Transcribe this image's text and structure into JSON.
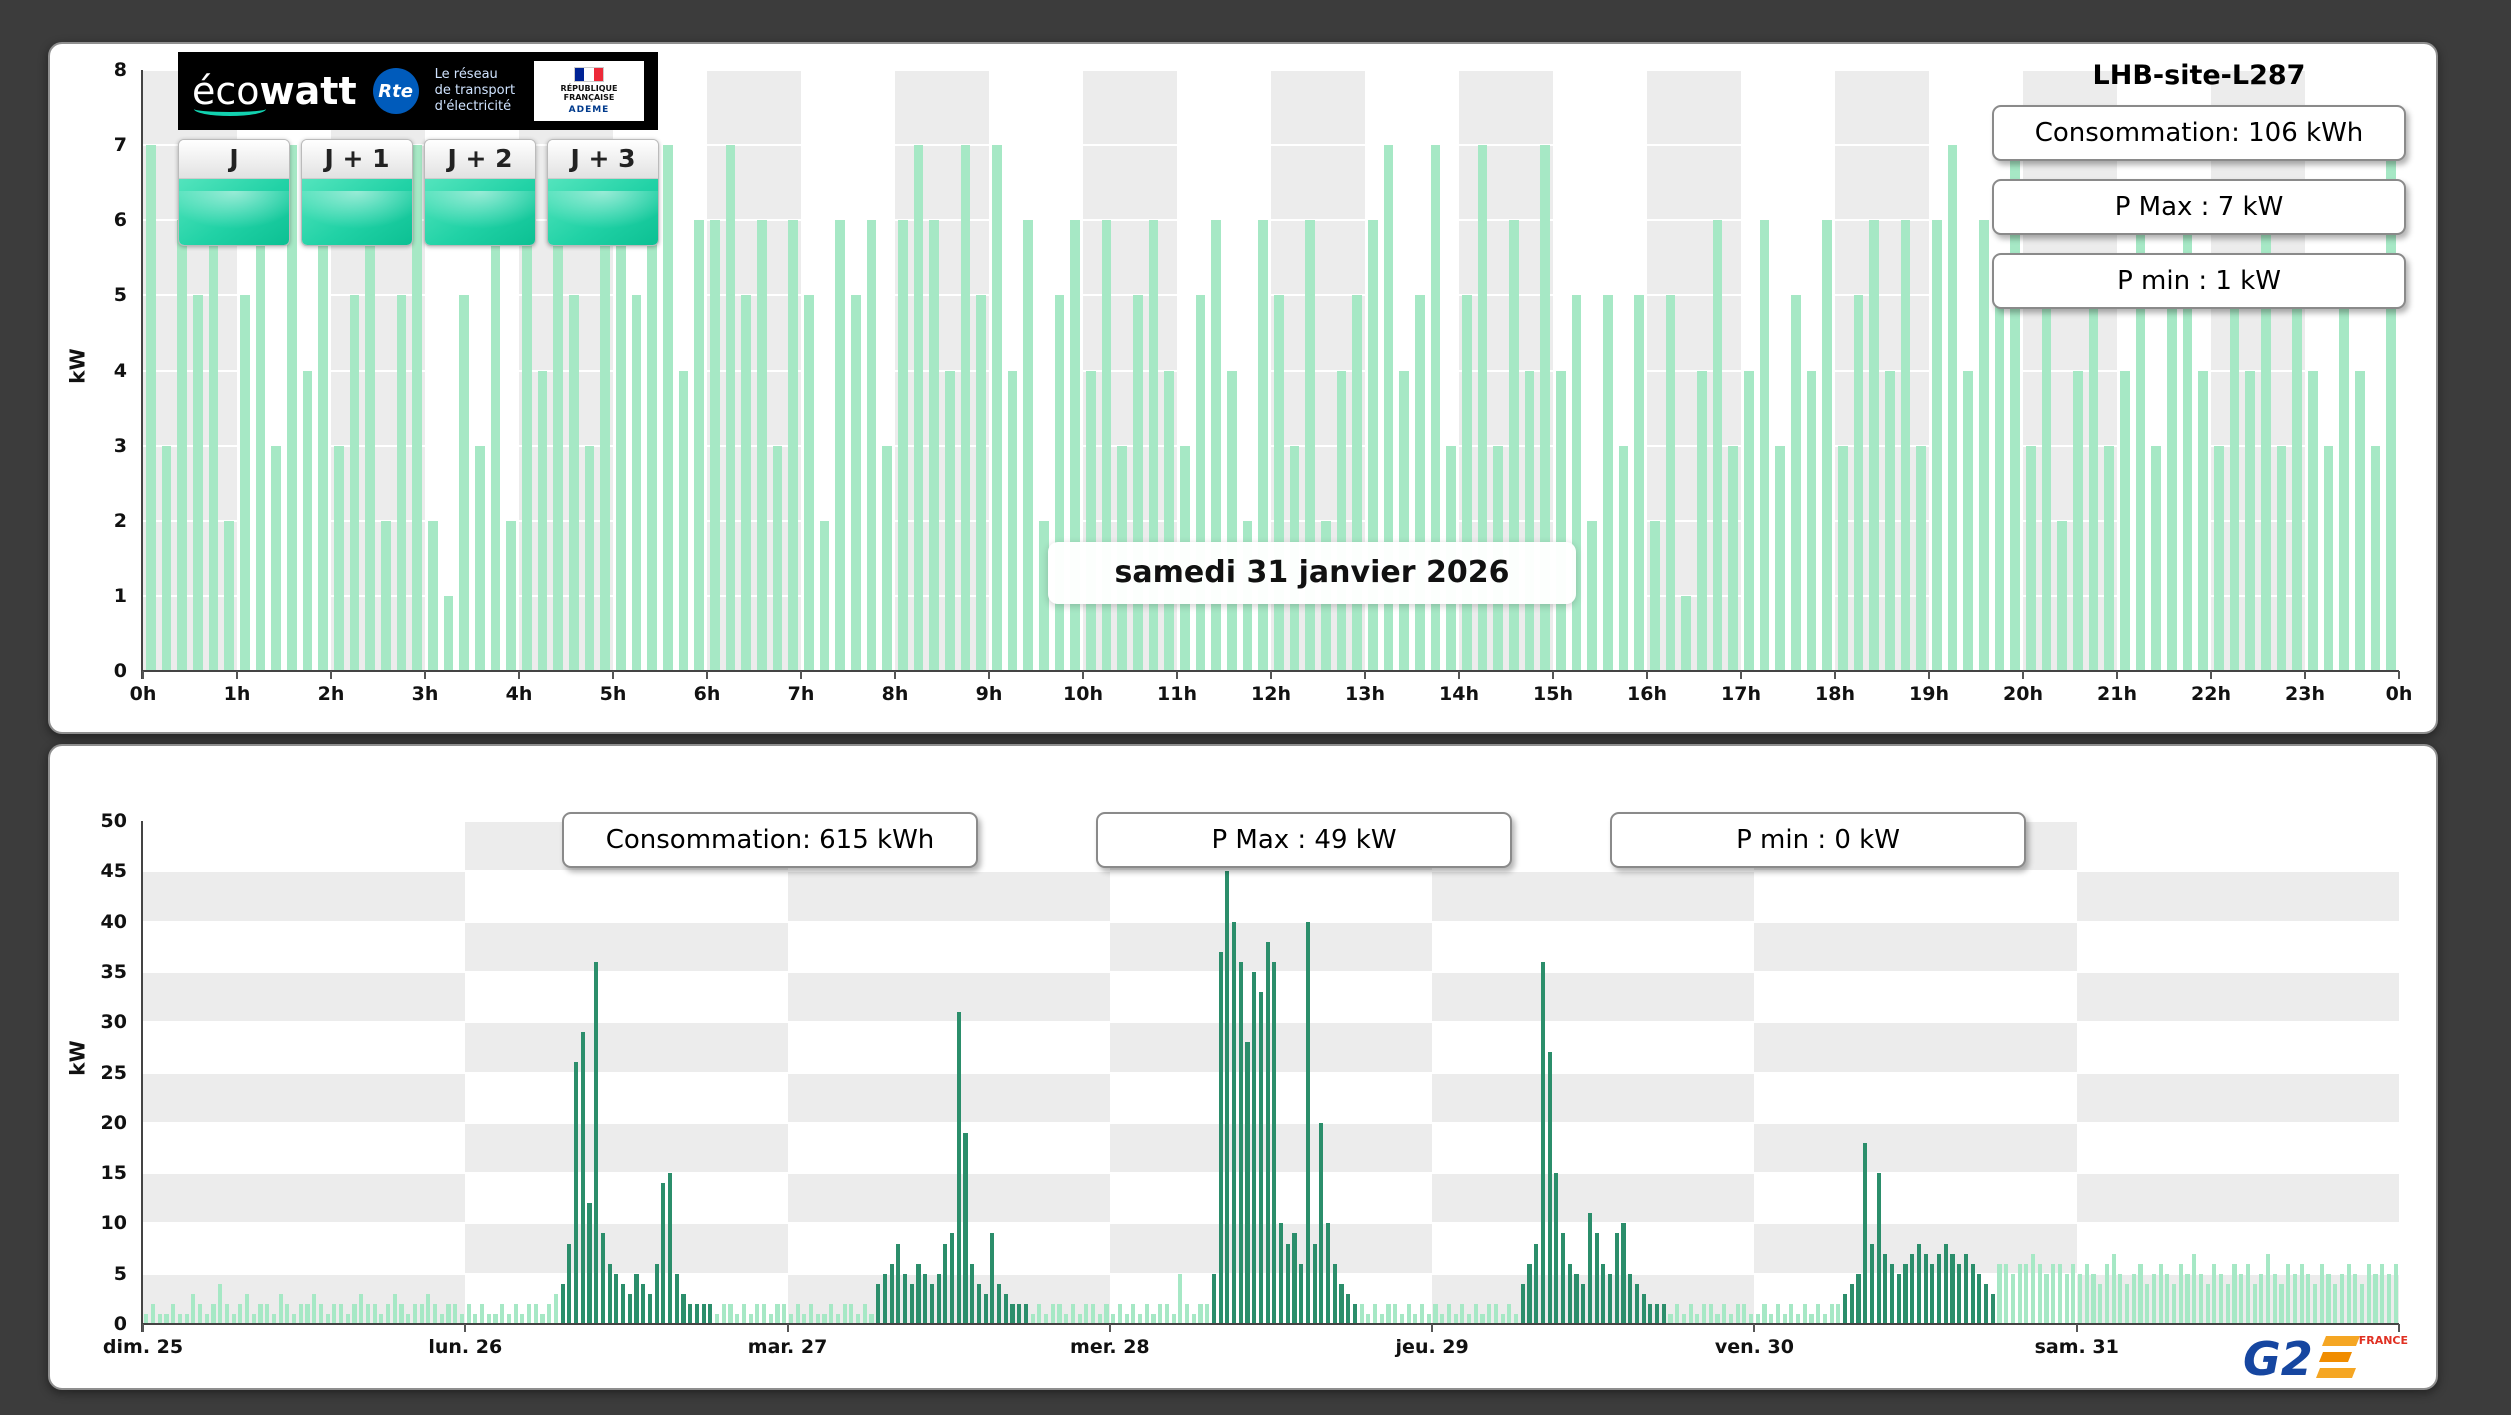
{
  "top_panel": {
    "site_title": "LHB-site-L287",
    "stats": [
      {
        "label": "Consommation: 106 kWh"
      },
      {
        "label": "P Max :  7 kW"
      },
      {
        "label": "P min : 1 kW"
      }
    ],
    "ecowatt": {
      "brand_light": "éco",
      "brand_bold": "watt",
      "rte_badge": "Rte",
      "rte_caption": "Le réseau de transport d'électricité",
      "gov_caption": "RÉPUBLIQUE FRANÇAISE",
      "ademe": "ADEME",
      "tabs": [
        {
          "label": "J"
        },
        {
          "label": "J + 1"
        },
        {
          "label": "J + 2"
        },
        {
          "label": "J + 3"
        }
      ]
    }
  },
  "bottom_panel": {
    "stats": [
      {
        "label": "Consommation: 615 kWh"
      },
      {
        "label": "P Max :  49 kW"
      },
      {
        "label": "P min : 0 kW"
      }
    ],
    "logo": {
      "g2": "G2",
      "france": "FRANCE"
    }
  },
  "colors": {
    "bar_light": "#a6e8c5",
    "bar_dark": "#2b8e6b",
    "band_gray": "#ececec",
    "page_background": "#3c3c3c",
    "ecowatt_teal": "#12d2b0",
    "rte_blue": "#005bbb",
    "g2e_blue": "#1646a0",
    "g2e_orange": "#f5a623"
  },
  "chart_data": [
    {
      "type": "bar",
      "title": "samedi 31 janvier 2026",
      "ylabel": "kW",
      "ylim": [
        0,
        8
      ],
      "yticks": [
        0,
        1,
        2,
        3,
        4,
        5,
        6,
        7,
        8
      ],
      "xticklabels": [
        "0h",
        "1h",
        "2h",
        "3h",
        "4h",
        "5h",
        "6h",
        "7h",
        "8h",
        "9h",
        "10h",
        "11h",
        "12h",
        "13h",
        "14h",
        "15h",
        "16h",
        "17h",
        "18h",
        "19h",
        "20h",
        "21h",
        "22h",
        "23h",
        "0h"
      ],
      "interval_minutes": 10,
      "bar_color": "#a6e8c5",
      "grid": "hour-stripes",
      "values": [
        7,
        3,
        6,
        5,
        7,
        2,
        5,
        6,
        3,
        7,
        4,
        6,
        3,
        5,
        6,
        2,
        5,
        7,
        2,
        1,
        5,
        3,
        6,
        2,
        6,
        4,
        7,
        5,
        3,
        6,
        7,
        5,
        6,
        7,
        4,
        6,
        6,
        7,
        5,
        6,
        3,
        6,
        5,
        2,
        6,
        5,
        6,
        3,
        6,
        7,
        6,
        4,
        7,
        5,
        7,
        4,
        6,
        2,
        5,
        6,
        4,
        6,
        3,
        5,
        6,
        4,
        3,
        5,
        6,
        4,
        2,
        6,
        5,
        3,
        6,
        2,
        4,
        5,
        6,
        7,
        4,
        5,
        7,
        3,
        5,
        7,
        3,
        6,
        4,
        7,
        4,
        5,
        2,
        5,
        3,
        5,
        2,
        5,
        1,
        4,
        6,
        3,
        4,
        6,
        3,
        5,
        4,
        6,
        3,
        5,
        6,
        4,
        6,
        3,
        6,
        7,
        4,
        6,
        5,
        7,
        3,
        5,
        2,
        4,
        5,
        3,
        4,
        6,
        3,
        5,
        6,
        4,
        3,
        5,
        4,
        6,
        3,
        5,
        4,
        3,
        5,
        4,
        3,
        7
      ]
    },
    {
      "type": "bar",
      "title": "",
      "ylabel": "kW",
      "ylim": [
        0,
        50
      ],
      "yticks": [
        0,
        5,
        10,
        15,
        20,
        25,
        30,
        35,
        40,
        45,
        50
      ],
      "xticklabels": [
        "dim. 25",
        "lun. 26",
        "mar. 27",
        "mer. 28",
        "jeu. 29",
        "ven. 30",
        "sam. 31"
      ],
      "interval_minutes": 30,
      "bar_color": "#a6e8c5",
      "peak_color": "#2b8e6b",
      "grid": "checkerboard",
      "dark_ranges": [
        [
          62,
          84
        ],
        [
          109,
          131
        ],
        [
          159,
          180
        ],
        [
          205,
          226
        ],
        [
          253,
          275
        ]
      ],
      "values": [
        1,
        2,
        1,
        1,
        2,
        1,
        1,
        3,
        2,
        1,
        2,
        4,
        2,
        1,
        2,
        3,
        1,
        2,
        2,
        1,
        3,
        2,
        1,
        2,
        2,
        3,
        2,
        1,
        2,
        2,
        1,
        2,
        3,
        2,
        2,
        1,
        2,
        3,
        2,
        1,
        2,
        2,
        3,
        2,
        1,
        2,
        2,
        1,
        2,
        1,
        2,
        1,
        1,
        2,
        1,
        2,
        1,
        2,
        2,
        1,
        2,
        3,
        4,
        8,
        26,
        29,
        12,
        36,
        9,
        6,
        5,
        4,
        3,
        5,
        4,
        3,
        6,
        14,
        15,
        5,
        3,
        2,
        2,
        2,
        2,
        1,
        2,
        2,
        1,
        2,
        1,
        2,
        2,
        1,
        2,
        2,
        1,
        2,
        1,
        2,
        1,
        1,
        2,
        1,
        2,
        2,
        1,
        2,
        1,
        4,
        5,
        6,
        8,
        5,
        4,
        6,
        5,
        4,
        5,
        8,
        9,
        31,
        19,
        6,
        4,
        3,
        9,
        4,
        3,
        2,
        2,
        2,
        1,
        2,
        1,
        2,
        2,
        1,
        2,
        1,
        2,
        2,
        1,
        2,
        1,
        2,
        1,
        2,
        1,
        2,
        1,
        2,
        2,
        1,
        5,
        2,
        1,
        2,
        2,
        5,
        37,
        45,
        40,
        36,
        28,
        35,
        33,
        38,
        36,
        10,
        8,
        9,
        6,
        40,
        8,
        20,
        10,
        6,
        4,
        3,
        2,
        2,
        1,
        2,
        1,
        2,
        2,
        1,
        2,
        1,
        2,
        1,
        2,
        1,
        2,
        1,
        2,
        1,
        2,
        1,
        2,
        2,
        1,
        2,
        1,
        4,
        6,
        8,
        36,
        27,
        15,
        9,
        6,
        5,
        4,
        11,
        9,
        6,
        5,
        9,
        10,
        5,
        4,
        3,
        2,
        2,
        2,
        1,
        2,
        1,
        2,
        1,
        2,
        2,
        1,
        2,
        1,
        2,
        2,
        1,
        1,
        2,
        1,
        2,
        1,
        2,
        1,
        2,
        1,
        2,
        1,
        2,
        2,
        3,
        4,
        5,
        18,
        8,
        15,
        7,
        6,
        5,
        6,
        7,
        8,
        7,
        6,
        7,
        8,
        7,
        6,
        7,
        6,
        5,
        4,
        3,
        6,
        6,
        5,
        6,
        6,
        7,
        6,
        5,
        6,
        6,
        5,
        6,
        5,
        6,
        5,
        4,
        6,
        7,
        5,
        4,
        5,
        6,
        4,
        5,
        6,
        5,
        4,
        6,
        5,
        7,
        5,
        4,
        6,
        5,
        4,
        6,
        5,
        6,
        4,
        5,
        7,
        5,
        4,
        6,
        5,
        6,
        5,
        4,
        6,
        5,
        4,
        5,
        6,
        5,
        4,
        6,
        5,
        6,
        5,
        6
      ]
    }
  ]
}
